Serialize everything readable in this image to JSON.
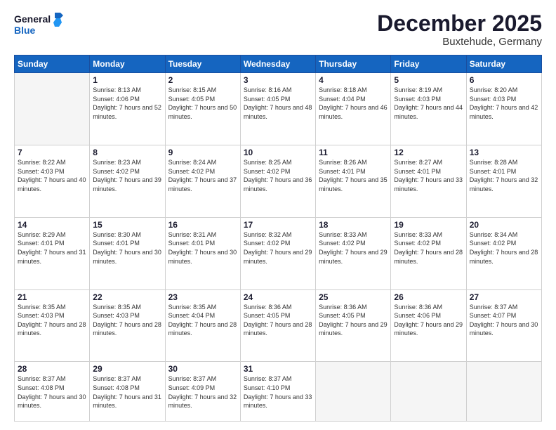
{
  "logo": {
    "line1": "General",
    "line2": "Blue"
  },
  "title": "December 2025",
  "subtitle": "Buxtehude, Germany",
  "weekdays": [
    "Sunday",
    "Monday",
    "Tuesday",
    "Wednesday",
    "Thursday",
    "Friday",
    "Saturday"
  ],
  "weeks": [
    [
      {
        "day": "",
        "empty": true
      },
      {
        "day": "1",
        "sunrise": "8:13 AM",
        "sunset": "4:06 PM",
        "daylight": "7 hours and 52 minutes."
      },
      {
        "day": "2",
        "sunrise": "8:15 AM",
        "sunset": "4:05 PM",
        "daylight": "7 hours and 50 minutes."
      },
      {
        "day": "3",
        "sunrise": "8:16 AM",
        "sunset": "4:05 PM",
        "daylight": "7 hours and 48 minutes."
      },
      {
        "day": "4",
        "sunrise": "8:18 AM",
        "sunset": "4:04 PM",
        "daylight": "7 hours and 46 minutes."
      },
      {
        "day": "5",
        "sunrise": "8:19 AM",
        "sunset": "4:03 PM",
        "daylight": "7 hours and 44 minutes."
      },
      {
        "day": "6",
        "sunrise": "8:20 AM",
        "sunset": "4:03 PM",
        "daylight": "7 hours and 42 minutes."
      }
    ],
    [
      {
        "day": "7",
        "sunrise": "8:22 AM",
        "sunset": "4:03 PM",
        "daylight": "7 hours and 40 minutes."
      },
      {
        "day": "8",
        "sunrise": "8:23 AM",
        "sunset": "4:02 PM",
        "daylight": "7 hours and 39 minutes."
      },
      {
        "day": "9",
        "sunrise": "8:24 AM",
        "sunset": "4:02 PM",
        "daylight": "7 hours and 37 minutes."
      },
      {
        "day": "10",
        "sunrise": "8:25 AM",
        "sunset": "4:02 PM",
        "daylight": "7 hours and 36 minutes."
      },
      {
        "day": "11",
        "sunrise": "8:26 AM",
        "sunset": "4:01 PM",
        "daylight": "7 hours and 35 minutes."
      },
      {
        "day": "12",
        "sunrise": "8:27 AM",
        "sunset": "4:01 PM",
        "daylight": "7 hours and 33 minutes."
      },
      {
        "day": "13",
        "sunrise": "8:28 AM",
        "sunset": "4:01 PM",
        "daylight": "7 hours and 32 minutes."
      }
    ],
    [
      {
        "day": "14",
        "sunrise": "8:29 AM",
        "sunset": "4:01 PM",
        "daylight": "7 hours and 31 minutes."
      },
      {
        "day": "15",
        "sunrise": "8:30 AM",
        "sunset": "4:01 PM",
        "daylight": "7 hours and 30 minutes."
      },
      {
        "day": "16",
        "sunrise": "8:31 AM",
        "sunset": "4:01 PM",
        "daylight": "7 hours and 30 minutes."
      },
      {
        "day": "17",
        "sunrise": "8:32 AM",
        "sunset": "4:02 PM",
        "daylight": "7 hours and 29 minutes."
      },
      {
        "day": "18",
        "sunrise": "8:33 AM",
        "sunset": "4:02 PM",
        "daylight": "7 hours and 29 minutes."
      },
      {
        "day": "19",
        "sunrise": "8:33 AM",
        "sunset": "4:02 PM",
        "daylight": "7 hours and 28 minutes."
      },
      {
        "day": "20",
        "sunrise": "8:34 AM",
        "sunset": "4:02 PM",
        "daylight": "7 hours and 28 minutes."
      }
    ],
    [
      {
        "day": "21",
        "sunrise": "8:35 AM",
        "sunset": "4:03 PM",
        "daylight": "7 hours and 28 minutes."
      },
      {
        "day": "22",
        "sunrise": "8:35 AM",
        "sunset": "4:03 PM",
        "daylight": "7 hours and 28 minutes."
      },
      {
        "day": "23",
        "sunrise": "8:35 AM",
        "sunset": "4:04 PM",
        "daylight": "7 hours and 28 minutes."
      },
      {
        "day": "24",
        "sunrise": "8:36 AM",
        "sunset": "4:05 PM",
        "daylight": "7 hours and 28 minutes."
      },
      {
        "day": "25",
        "sunrise": "8:36 AM",
        "sunset": "4:05 PM",
        "daylight": "7 hours and 29 minutes."
      },
      {
        "day": "26",
        "sunrise": "8:36 AM",
        "sunset": "4:06 PM",
        "daylight": "7 hours and 29 minutes."
      },
      {
        "day": "27",
        "sunrise": "8:37 AM",
        "sunset": "4:07 PM",
        "daylight": "7 hours and 30 minutes."
      }
    ],
    [
      {
        "day": "28",
        "sunrise": "8:37 AM",
        "sunset": "4:08 PM",
        "daylight": "7 hours and 30 minutes."
      },
      {
        "day": "29",
        "sunrise": "8:37 AM",
        "sunset": "4:08 PM",
        "daylight": "7 hours and 31 minutes."
      },
      {
        "day": "30",
        "sunrise": "8:37 AM",
        "sunset": "4:09 PM",
        "daylight": "7 hours and 32 minutes."
      },
      {
        "day": "31",
        "sunrise": "8:37 AM",
        "sunset": "4:10 PM",
        "daylight": "7 hours and 33 minutes."
      },
      {
        "day": "",
        "empty": true
      },
      {
        "day": "",
        "empty": true
      },
      {
        "day": "",
        "empty": true
      }
    ]
  ]
}
